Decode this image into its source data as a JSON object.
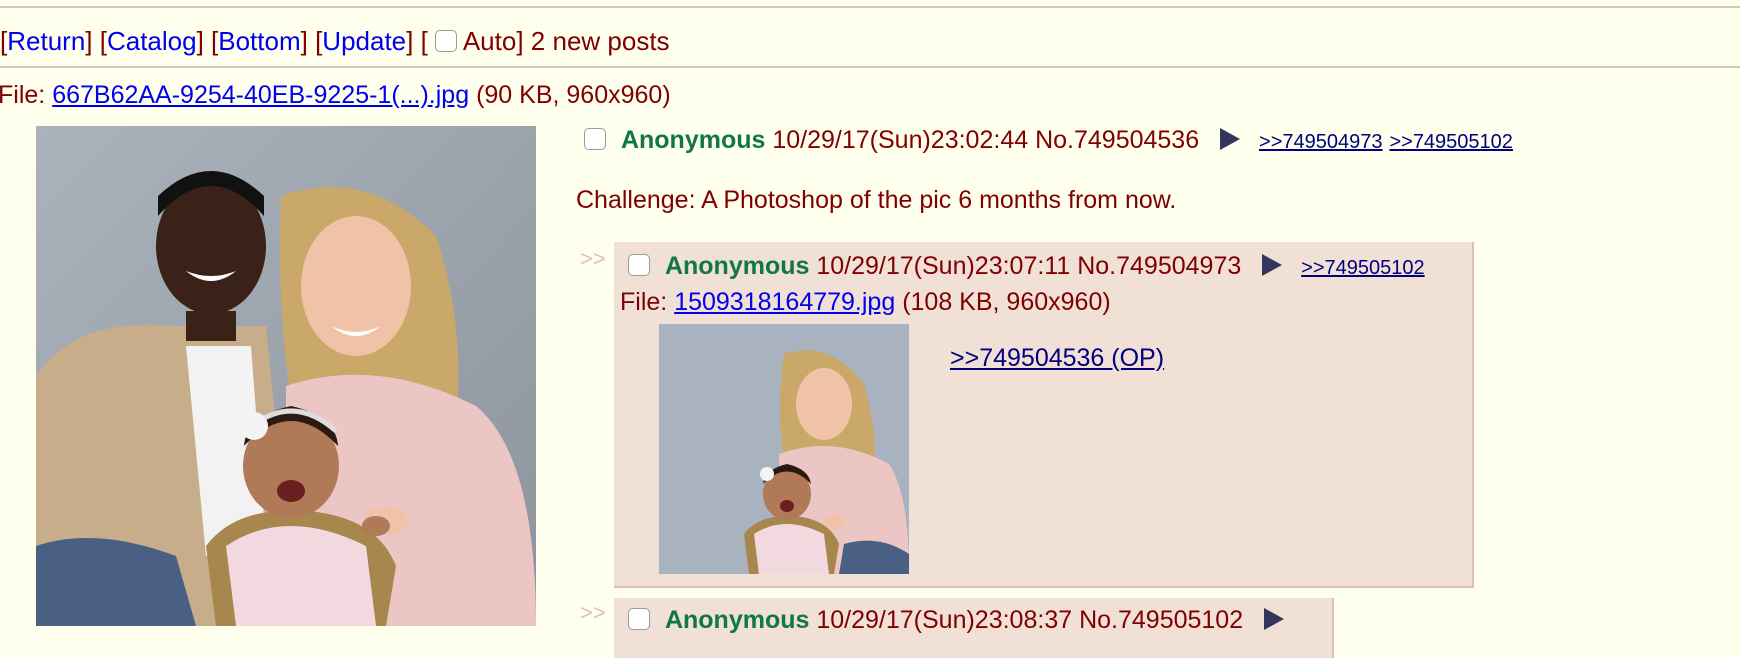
{
  "nav": {
    "return_label": "Return",
    "catalog_label": "Catalog",
    "bottom_label": "Bottom",
    "update_label": "Update",
    "auto_label": "Auto",
    "new_posts": "2 new posts"
  },
  "op": {
    "file_prefix": "File: ",
    "file_name": "667B62AA-9254-40EB-9225-1(...).jpg",
    "file_meta": "(90 KB, 960x960)",
    "name": "Anonymous",
    "datetime": "10/29/17(Sun)23:02:44",
    "number": "No.749504536",
    "backlinks": [
      ">>749504973",
      ">>749505102"
    ],
    "message": "Challenge: A Photoshop of the pic 6 months from now."
  },
  "reply1": {
    "marker": ">>",
    "name": "Anonymous",
    "datetime": "10/29/17(Sun)23:07:11",
    "number": "No.749504973",
    "backlinks": [
      ">>749505102"
    ],
    "file_prefix": "File: ",
    "file_name": "1509318164779.jpg",
    "file_meta": "(108 KB, 960x960)",
    "quote": ">>749504536 (OP)"
  },
  "reply2": {
    "marker": ">>",
    "name": "Anonymous",
    "datetime": "10/29/17(Sun)23:08:37",
    "number": "No.749505102"
  },
  "colors": {
    "background": "#ffffee",
    "text": "#800000",
    "name": "#117743",
    "link": "#0000ee",
    "reply_bg": "#f0e0d6"
  },
  "icons": {
    "post_menu": "triangle-right-icon",
    "select": "checkbox-icon"
  }
}
